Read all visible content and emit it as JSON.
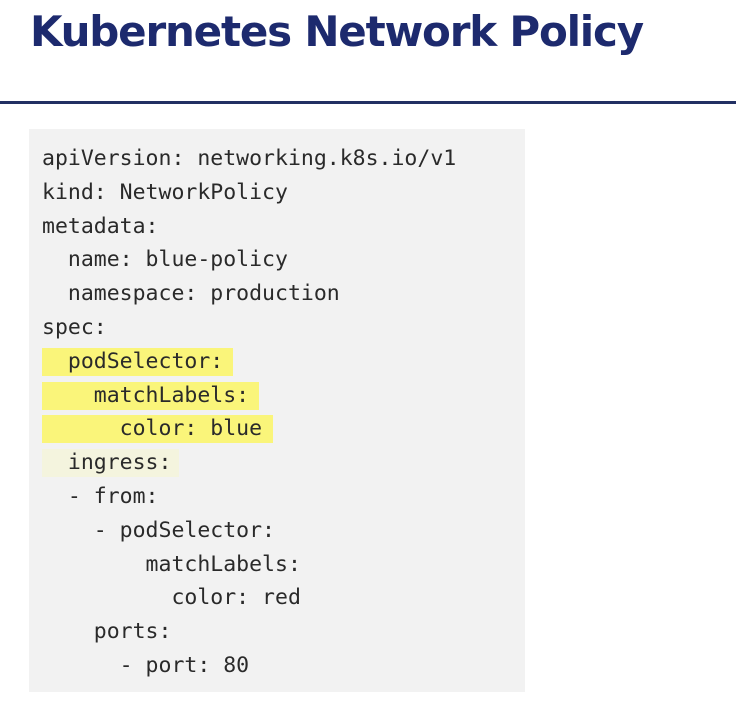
{
  "slide": {
    "title": "Kubernetes Network Policy"
  },
  "colors": {
    "title": "#1d2a6e",
    "rule": "#223063",
    "code_background": "#f2f2f2",
    "highlight": "#faf57a",
    "faint_highlight": "#f4f4de"
  },
  "code": {
    "language": "yaml",
    "lines": [
      {
        "text": "apiVersion: networking.k8s.io/v1",
        "highlight": "none"
      },
      {
        "text": "kind: NetworkPolicy",
        "highlight": "none"
      },
      {
        "text": "metadata:",
        "highlight": "none"
      },
      {
        "text": "  name: blue-policy",
        "highlight": "none"
      },
      {
        "text": "  namespace: production",
        "highlight": "none"
      },
      {
        "text": "spec:",
        "highlight": "none"
      },
      {
        "text": "  podSelector:",
        "highlight": "yellow"
      },
      {
        "text": "    matchLabels:",
        "highlight": "yellow"
      },
      {
        "text": "      color: blue",
        "highlight": "yellow"
      },
      {
        "text": "  ingress:",
        "highlight": "faint"
      },
      {
        "text": "  - from:",
        "highlight": "none"
      },
      {
        "text": "    - podSelector:",
        "highlight": "none"
      },
      {
        "text": "        matchLabels:",
        "highlight": "none"
      },
      {
        "text": "          color: red",
        "highlight": "none"
      },
      {
        "text": "    ports:",
        "highlight": "none"
      },
      {
        "text": "      - port: 80",
        "highlight": "none"
      }
    ]
  }
}
